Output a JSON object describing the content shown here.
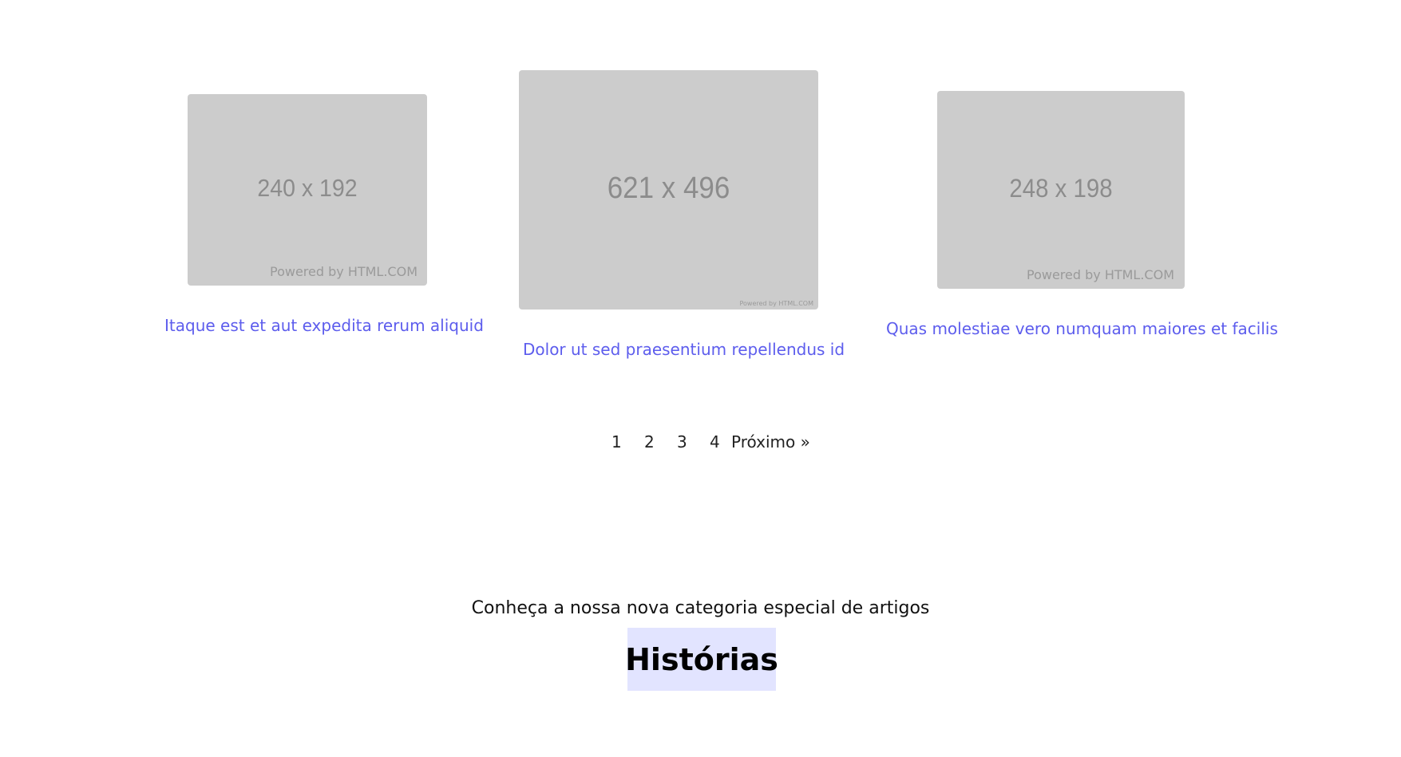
{
  "cards": [
    {
      "thumb_dims": "240 x 192",
      "thumb_powered": "Powered by HTML.COM",
      "title": "Itaque est et aut expedita rerum aliquid"
    },
    {
      "thumb_dims": "621 x 496",
      "thumb_powered": "Powered by HTML.COM",
      "title": "Dolor ut sed praesentium repellendus id"
    },
    {
      "thumb_dims": "248 x 198",
      "thumb_powered": "Powered by HTML.COM",
      "title": "Quas molestiae vero numquam maiores et facilis"
    }
  ],
  "pagination": {
    "pages": [
      "1",
      "2",
      "3",
      "4"
    ],
    "next_label": "Próximo »"
  },
  "promo": {
    "text": "Conheça a nossa nova categoria especial de artigos",
    "button_label": "Histórias"
  },
  "colors": {
    "link": "#5d5ded",
    "placeholder_bg": "#cccccc",
    "promo_bg": "#e2e4ff"
  }
}
